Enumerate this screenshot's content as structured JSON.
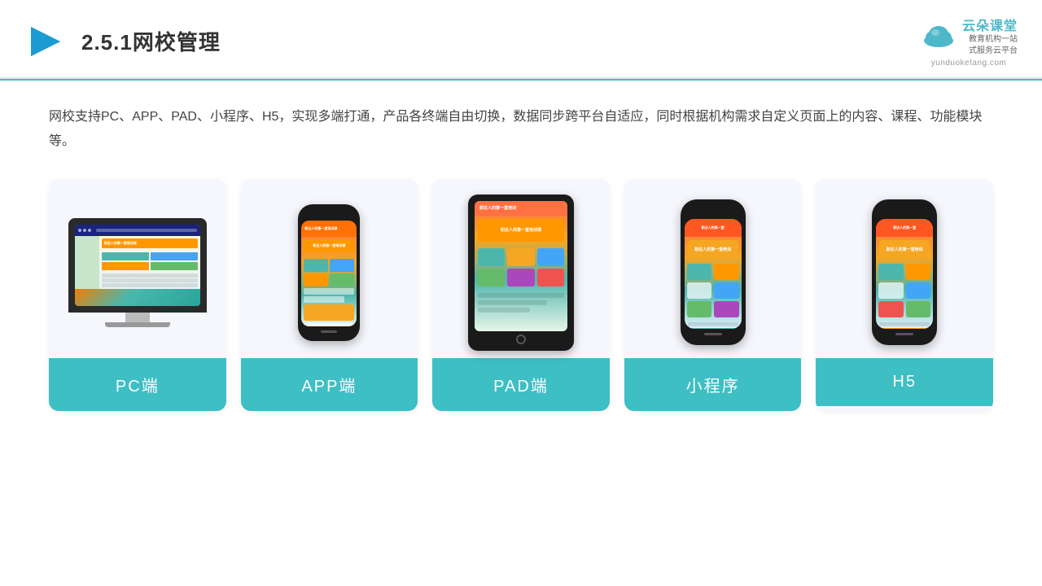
{
  "header": {
    "title": "2.5.1网校管理",
    "brand_name": "云朵课堂",
    "brand_domain": "yunduoketang.com",
    "brand_tagline_line1": "教育机构一站",
    "brand_tagline_line2": "式服务云平台"
  },
  "description": "网校支持PC、APP、PAD、小程序、H5，实现多端打通，产品各终端自由切换，数据同步跨平台自适应，同时根据机构需求自定义页面上的内容、课程、功能模块等。",
  "cards": [
    {
      "id": "pc",
      "label": "PC端"
    },
    {
      "id": "app",
      "label": "APP端"
    },
    {
      "id": "pad",
      "label": "PAD端"
    },
    {
      "id": "miniapp",
      "label": "小程序"
    },
    {
      "id": "h5",
      "label": "H5"
    }
  ],
  "colors": {
    "accent": "#3dbfc4",
    "title_color": "#333333",
    "text_color": "#444444"
  }
}
